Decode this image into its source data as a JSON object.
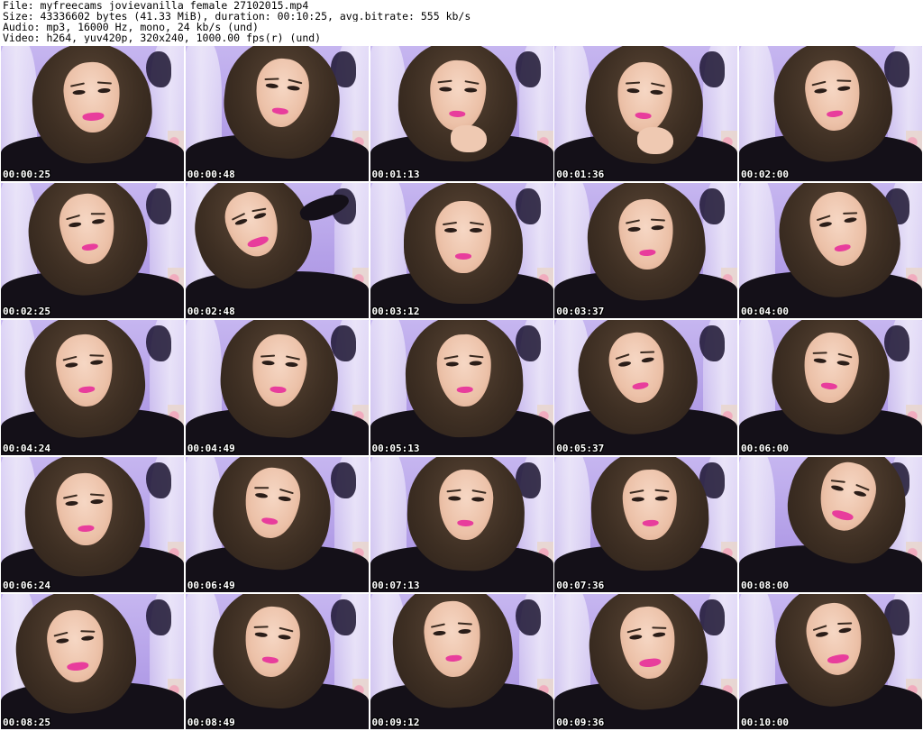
{
  "header": {
    "file": "File: myfreecams_jovievanilla_female_27102015.mp4",
    "size": "Size: 43336602 bytes (41.33 MiB), duration: 00:10:25, avg.bitrate: 555 kb/s",
    "audio": "Audio: mp3, 16000 Hz, mono, 24 kb/s (und)",
    "video": "Video: h264, yuv420p, 320x240, 1000.00 fps(r) (und)"
  },
  "thumbnails": [
    {
      "timestamp": "00:00:25"
    },
    {
      "timestamp": "00:00:48"
    },
    {
      "timestamp": "00:01:13"
    },
    {
      "timestamp": "00:01:36"
    },
    {
      "timestamp": "00:02:00"
    },
    {
      "timestamp": "00:02:25"
    },
    {
      "timestamp": "00:02:48"
    },
    {
      "timestamp": "00:03:12"
    },
    {
      "timestamp": "00:03:37"
    },
    {
      "timestamp": "00:04:00"
    },
    {
      "timestamp": "00:04:24"
    },
    {
      "timestamp": "00:04:49"
    },
    {
      "timestamp": "00:05:13"
    },
    {
      "timestamp": "00:05:37"
    },
    {
      "timestamp": "00:06:00"
    },
    {
      "timestamp": "00:06:24"
    },
    {
      "timestamp": "00:06:49"
    },
    {
      "timestamp": "00:07:13"
    },
    {
      "timestamp": "00:07:36"
    },
    {
      "timestamp": "00:08:00"
    },
    {
      "timestamp": "00:08:25"
    },
    {
      "timestamp": "00:08:49"
    },
    {
      "timestamp": "00:09:12"
    },
    {
      "timestamp": "00:09:36"
    },
    {
      "timestamp": "00:10:00"
    }
  ],
  "colors": {
    "background": "#ffffff",
    "header_text": "#000000",
    "timestamp_text": "#ffffff",
    "timestamp_outline": "#000000",
    "wall": "#b7a5e6",
    "hair": "#3e2f23",
    "skin": "#ecc1a8",
    "lips": "#e83d9c",
    "sweater": "#141018"
  }
}
